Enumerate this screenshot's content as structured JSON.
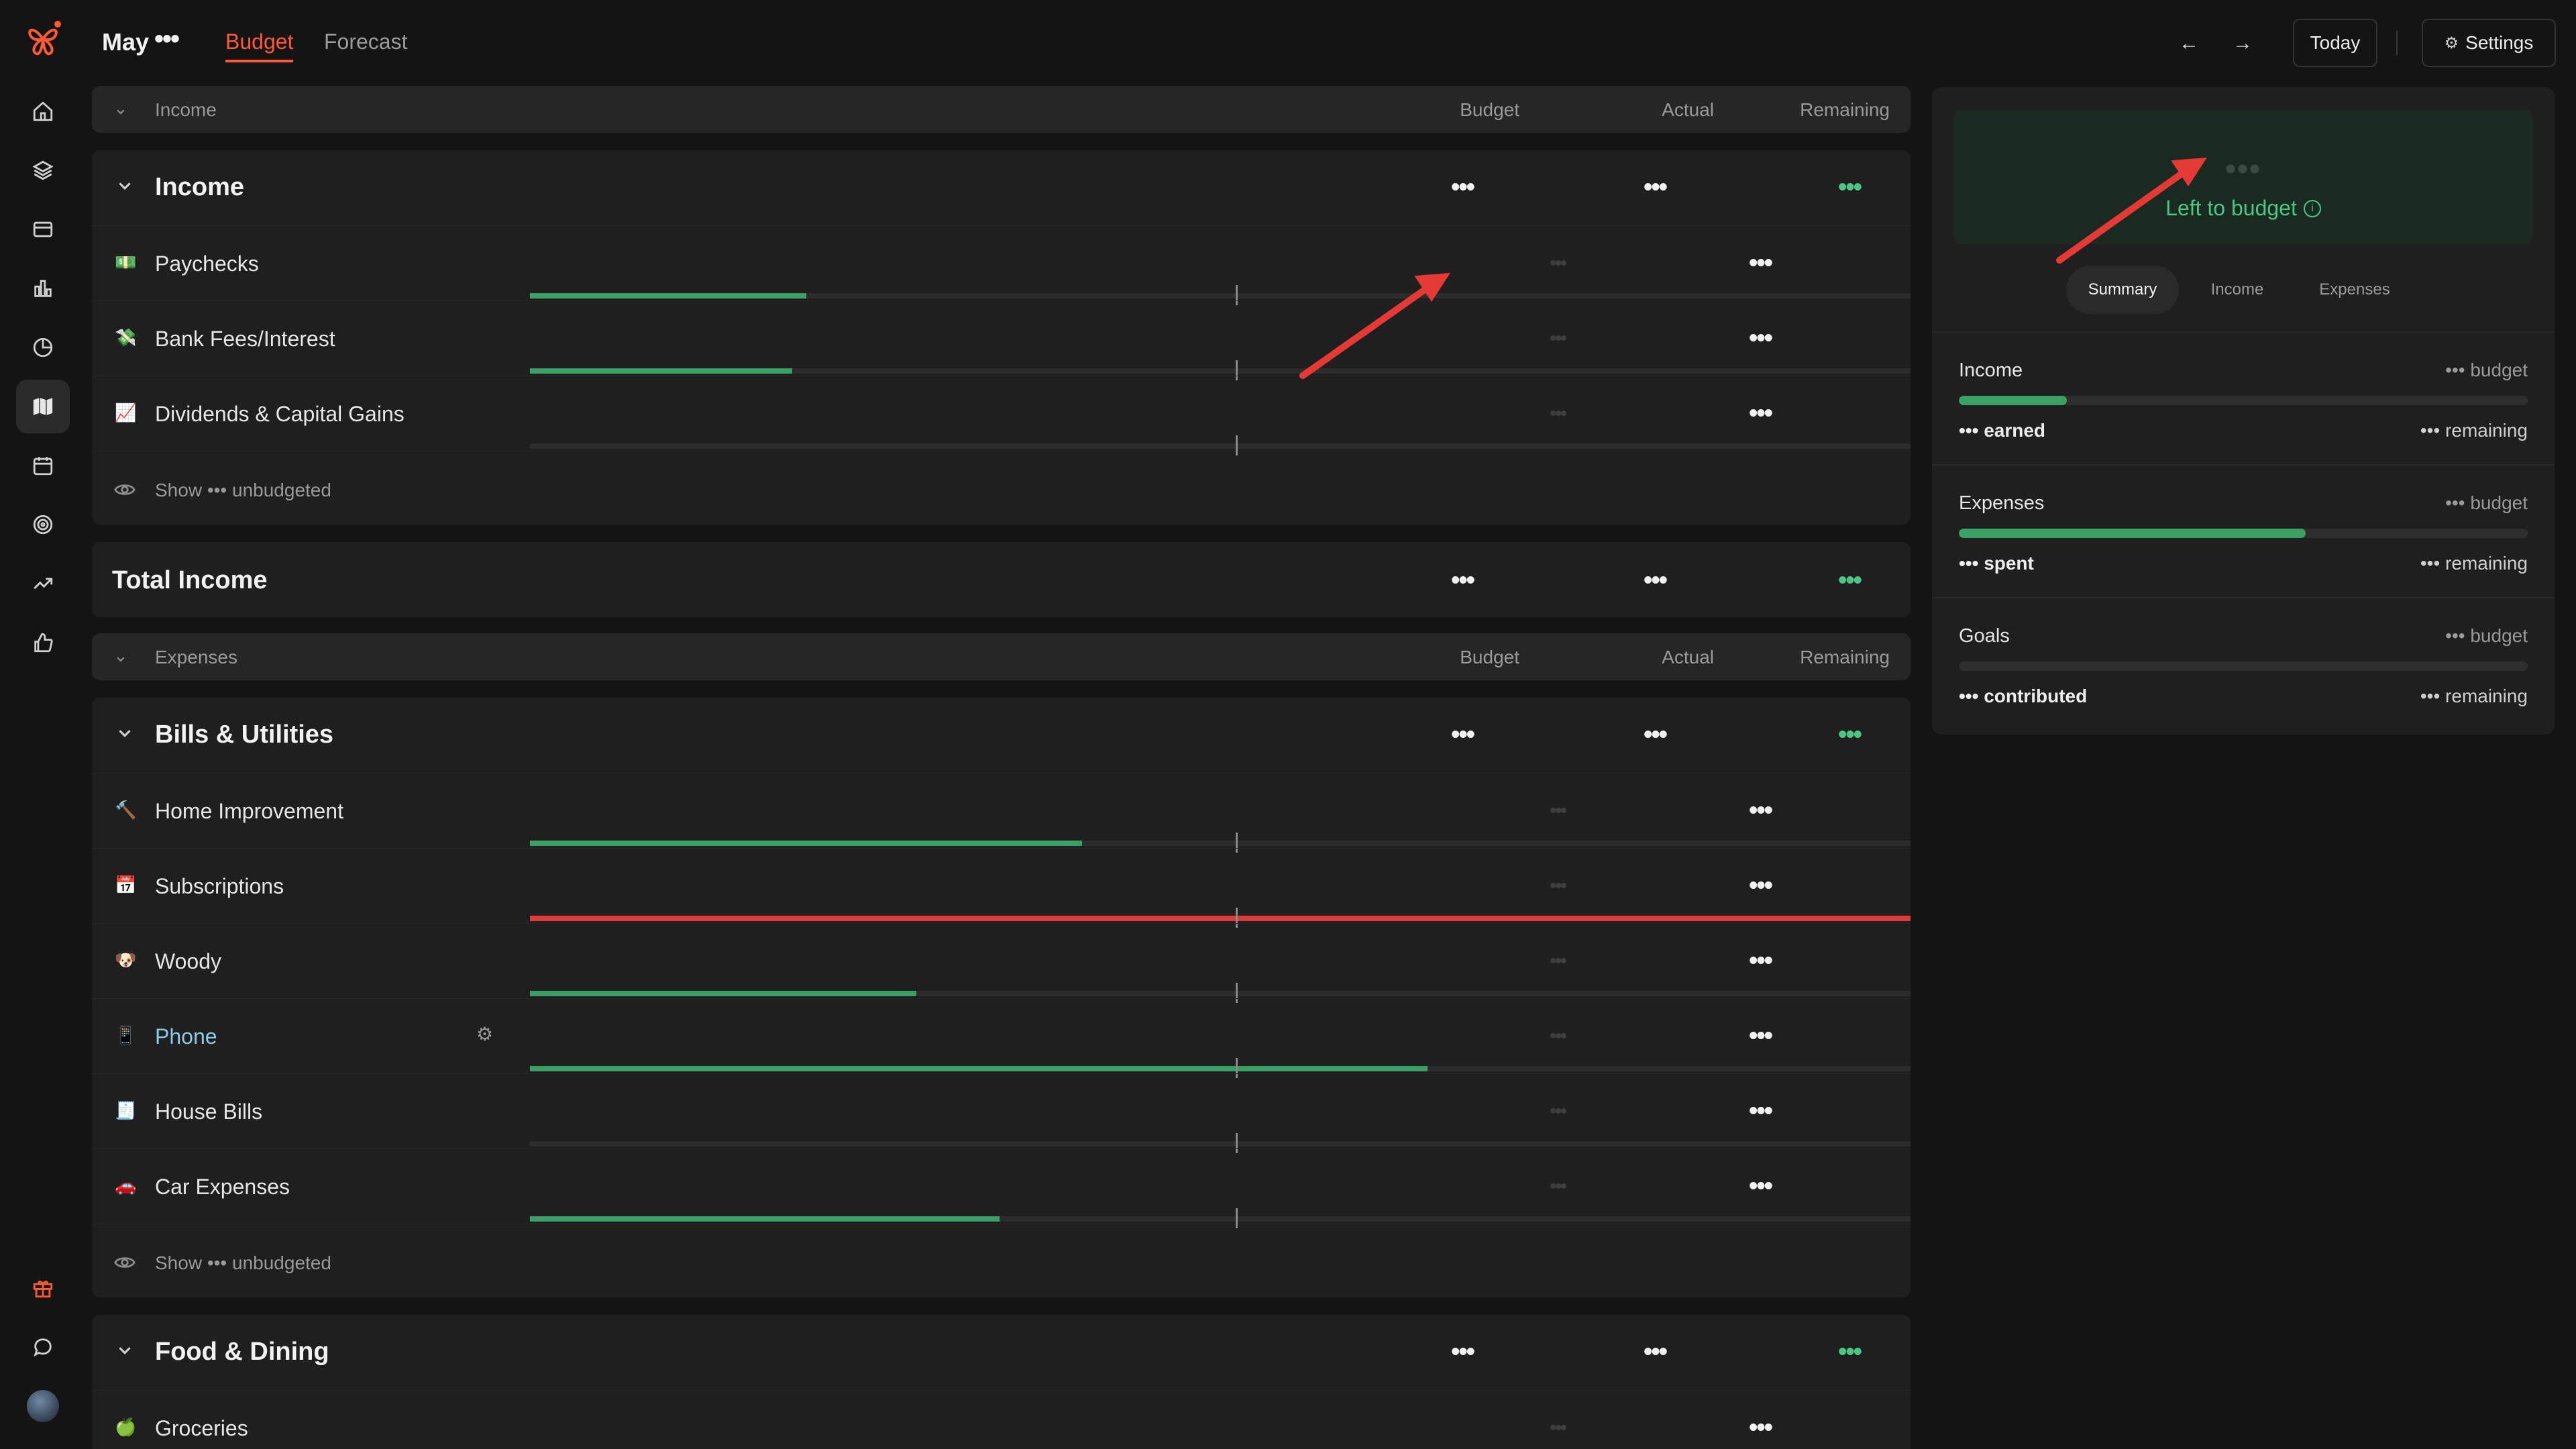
{
  "app": {
    "month": "May",
    "month_dots": "•••",
    "tabs": [
      "Budget",
      "Forecast"
    ],
    "active_tab": "Budget",
    "today_label": "Today",
    "settings_label": "Settings"
  },
  "colors": {
    "accent": "#ff5a36",
    "green": "#4cc684",
    "red": "#e03c3c",
    "blue": "#5fb8f0"
  },
  "nav": {
    "icons": [
      "home-icon",
      "layers-icon",
      "credit-card-icon",
      "bar-chart-icon",
      "pie-chart-icon",
      "map-icon",
      "calendar-icon",
      "target-icon",
      "trending-up-icon",
      "thumbs-up-icon"
    ],
    "bottom_icons": [
      "gift-icon",
      "chat-icon",
      "avatar"
    ],
    "selected": "map-icon"
  },
  "columns": {
    "budget": "Budget",
    "actual": "Actual",
    "remaining": "Remaining"
  },
  "masked": "•••",
  "income_section": {
    "header": "Income",
    "group": {
      "name": "Income",
      "budget": "•••",
      "actual": "•••",
      "remaining": "•••"
    },
    "rows": [
      {
        "emoji": "💵",
        "name": "Paychecks",
        "budget": "•••",
        "actual": "•••",
        "remaining": "•••",
        "progress": 0.2
      },
      {
        "emoji": "💸",
        "name": "Bank Fees/Interest",
        "budget": "•••",
        "actual": "•••",
        "remaining": "•••",
        "progress": 0.19
      },
      {
        "emoji": "📈",
        "name": "Dividends & Capital Gains",
        "budget": "•••",
        "actual": "•••",
        "remaining": "•••",
        "progress": 0
      }
    ],
    "show_unbudgeted": "Show ••• unbudgeted"
  },
  "total_income": {
    "label": "Total Income",
    "budget": "•••",
    "actual": "•••",
    "remaining": "•••"
  },
  "expenses_section": {
    "header": "Expenses",
    "group": {
      "name": "Bills & Utilities",
      "budget": "•••",
      "actual": "•••",
      "remaining": "•••"
    },
    "rows": [
      {
        "emoji": "🔨",
        "name": "Home Improvement",
        "budget": "•••",
        "actual": "•••",
        "remaining": "•••",
        "progress": 0.4,
        "over": false
      },
      {
        "emoji": "📅",
        "name": "Subscriptions",
        "budget": "•••",
        "actual": "•••",
        "remaining": "-•••",
        "progress": 1.0,
        "over": true
      },
      {
        "emoji": "🐶",
        "name": "Woody",
        "budget": "•••",
        "actual": "•••",
        "remaining": "•••",
        "progress": 0.28,
        "over": false
      },
      {
        "emoji": "📱",
        "name": "Phone",
        "budget": "•••",
        "actual": "•••",
        "remaining": "•••",
        "progress": 0.65,
        "over": false
      },
      {
        "emoji": "🧾",
        "name": "House Bills",
        "budget": "•••",
        "actual": "•••",
        "remaining": "•••",
        "progress": 0,
        "over": false
      },
      {
        "emoji": "🚗",
        "name": "Car Expenses",
        "budget": "•••",
        "actual": "•••",
        "remaining": "•••",
        "progress": 0.34,
        "over": false
      }
    ],
    "show_unbudgeted": "Show ••• unbudgeted"
  },
  "food_section": {
    "group": {
      "name": "Food & Dining",
      "budget": "•••",
      "actual": "•••",
      "remaining": "•••"
    },
    "rows": [
      {
        "emoji": "🍏",
        "name": "Groceries",
        "budget": "•••",
        "actual": "•••",
        "remaining": "•••"
      }
    ]
  },
  "summary": {
    "amount": "•••",
    "left_label": "Left to budget",
    "tabs": [
      "Summary",
      "Income",
      "Expenses"
    ],
    "active_tab": "Summary",
    "income": {
      "label": "Income",
      "budget": "••• budget",
      "sub": "••• earned",
      "remaining": "••• remaining",
      "progress": 0.19
    },
    "expenses": {
      "label": "Expenses",
      "budget": "••• budget",
      "sub": "••• spent",
      "remaining": "••• remaining",
      "progress": 0.61
    },
    "goals": {
      "label": "Goals",
      "budget": "••• budget",
      "sub": "••• contributed",
      "remaining": "••• remaining",
      "progress": 0
    }
  }
}
